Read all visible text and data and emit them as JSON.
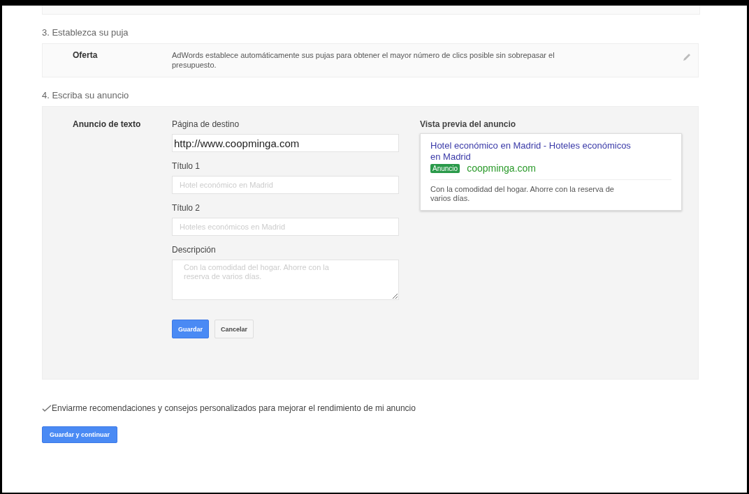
{
  "bid_section": {
    "heading": "3. Establezca su puja",
    "label": "Oferta",
    "description": "AdWords establece automáticamente sus pujas para obtener el mayor número de clics posible sin sobrepasar el presupuesto."
  },
  "ad_section": {
    "heading": "4. Escriba su anuncio",
    "label": "Anuncio de texto",
    "fields": [
      {
        "kind": "input",
        "label": "Página de destino",
        "value": "http://www.coopminga.com"
      },
      {
        "kind": "input",
        "label": "Título 1",
        "placeholder": "Hotel económico en Madrid"
      },
      {
        "kind": "input",
        "label": "Título 2",
        "placeholder": "Hoteles económicos en Madrid"
      },
      {
        "kind": "textarea",
        "label": "Descripción",
        "placeholder": "Con la comodidad del hogar. Ahorre con la reserva de varios días."
      }
    ],
    "buttons": [
      {
        "label": "Guardar",
        "primary": true
      },
      {
        "label": "Cancelar",
        "primary": false
      }
    ],
    "preview": {
      "heading": "Vista previa del anuncio",
      "title": "Hotel económico en Madrid - Hoteles económicos en Madrid",
      "badge": "Anuncio",
      "url": "coopminga.com",
      "description": "Con la comodidad del hogar. Ahorre con la reserva de varios días."
    }
  },
  "recommendations": {
    "checked": true,
    "label": "Enviarme recomendaciones y consejos personalizados para mejorar el rendimiento de mi anuncio"
  },
  "save_button": "Guardar y continuar"
}
